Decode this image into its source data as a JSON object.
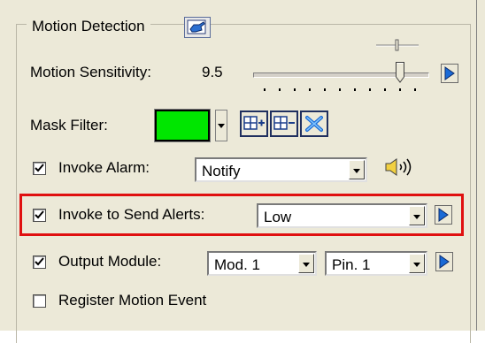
{
  "group": {
    "title": "Motion Detection",
    "title_icon": "hand-pointer-icon"
  },
  "sensitivity": {
    "label": "Motion Sensitivity:",
    "value_text": "9.5",
    "slider_level": 0.85
  },
  "mask_filter": {
    "label": "Mask Filter:",
    "color": "#00e600",
    "tools": [
      "grid-add-icon",
      "grid-remove-icon",
      "grid-clear-icon"
    ]
  },
  "invoke_alarm": {
    "label": "Invoke Alarm:",
    "checked": true,
    "value": "Notify",
    "icon": "speaker-icon"
  },
  "send_alerts": {
    "label": "Invoke to Send Alerts:",
    "checked": true,
    "value": "Low",
    "highlight_color": "#e01010"
  },
  "output_module": {
    "label": "Output Module:",
    "checked": true,
    "module": "Mod. 1",
    "pin": "Pin. 1"
  },
  "register_event": {
    "label": "Register Motion Event",
    "checked": false
  },
  "colors": {
    "panel": "#ece9d8",
    "play_button": "#1a6ad6"
  }
}
